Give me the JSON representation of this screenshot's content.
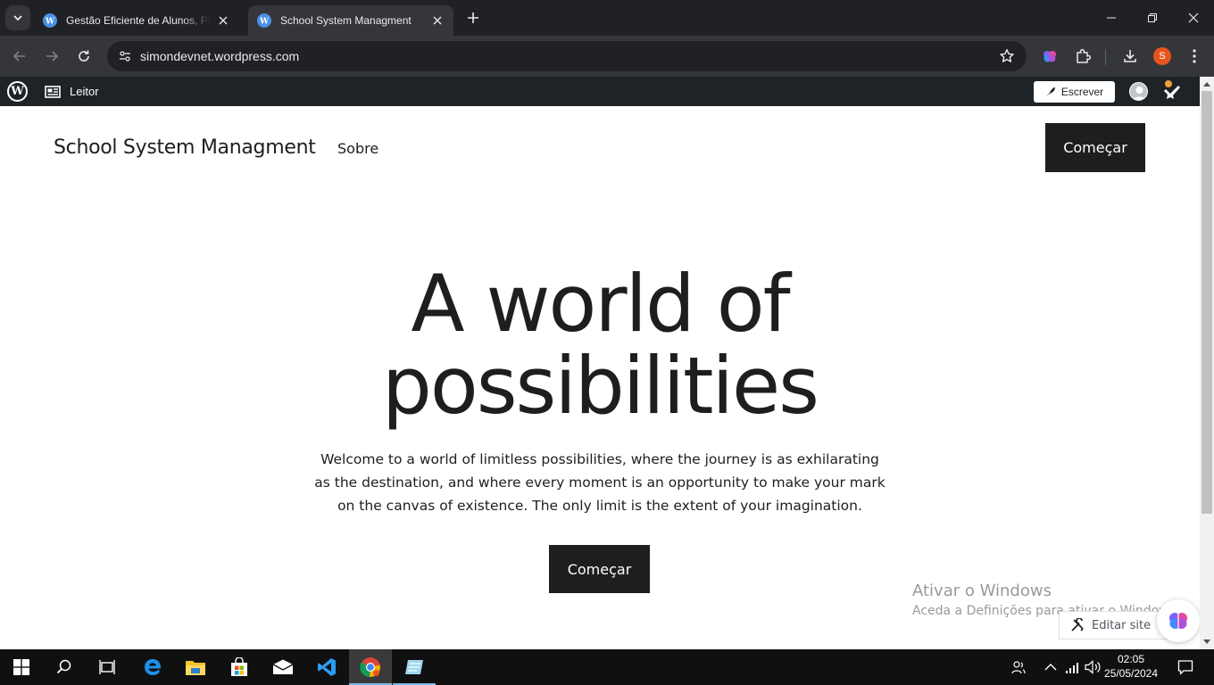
{
  "browser": {
    "tabs": [
      {
        "title": "Gestão Eficiente de Alunos, Professores",
        "active": false
      },
      {
        "title": "School System Managment",
        "active": true
      }
    ],
    "url": "simondevnet.wordpress.com",
    "profile_initial": "S"
  },
  "wp_admin_bar": {
    "reader_label": "Leitor",
    "write_label": "Escrever"
  },
  "site": {
    "title": "School System Managment",
    "nav": [
      "Sobre"
    ],
    "header_cta": "Começar"
  },
  "hero": {
    "title_line1": "A world of",
    "title_line2": "possibilities",
    "text": "Welcome to a world of limitless possibilities, where the journey is as exhilarating as the destination, and where every moment is an opportunity to make your mark on the canvas of existence. The only limit is the extent of your imagination.",
    "cta": "Começar"
  },
  "overlay": {
    "activate_title": "Ativar o Windows",
    "activate_text": "Aceda a Definições para ativar o Windows.",
    "edit_site": "Editar site"
  },
  "taskbar": {
    "time": "02:05",
    "date": "25/05/2024"
  },
  "colors": {
    "accent_dark": "#1e1e1e",
    "wp_bar": "#1d2327",
    "browser_frame": "#202124",
    "toolbar": "#35363a"
  }
}
